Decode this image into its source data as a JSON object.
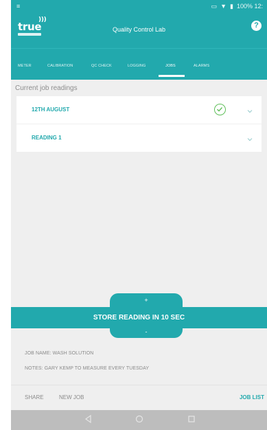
{
  "status_bar": {
    "left_icon": "menu-icon",
    "right_text": "100% 12:"
  },
  "app": {
    "logo_text": "true",
    "title": "Quality Control Lab",
    "help_icon": "help-icon"
  },
  "tabs": [
    {
      "label": "METER",
      "active": false
    },
    {
      "label": "CALIBRATION",
      "active": false
    },
    {
      "label": "QC CHECK",
      "active": false
    },
    {
      "label": "LOGGING",
      "active": false
    },
    {
      "label": "JOBS",
      "active": true
    },
    {
      "label": "ALARMS",
      "active": false
    }
  ],
  "main": {
    "section_label": "Current job readings",
    "readings": [
      {
        "label": "12TH AUGUST",
        "checked": true
      },
      {
        "label": "READING 1",
        "checked": false
      }
    ]
  },
  "store": {
    "increment_label": "+",
    "button_label": "STORE READING IN 10 SEC",
    "decrement_label": "-"
  },
  "job": {
    "name_line": "JOB NAME: WASH SOLUTION",
    "notes_line": "NOTES: GARY KEMP TO MEASURE EVERY TUESDAY"
  },
  "actions": {
    "share": "SHARE",
    "new_job": "NEW JOB",
    "job_list": "JOB LIST"
  },
  "colors": {
    "accent": "#22a9ad",
    "background": "#efefef",
    "check": "#5fbf5a"
  }
}
